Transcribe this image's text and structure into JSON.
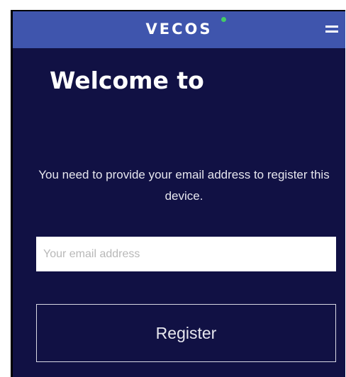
{
  "header": {
    "brand": "VECOS",
    "menu_icon": "hamburger-menu-icon",
    "status_dot_color": "#44cc66"
  },
  "main": {
    "title": "Welcome to",
    "instruction": "You need to provide your email address to register this device.",
    "email": {
      "value": "",
      "placeholder": "Your email address"
    },
    "register_label": "Register"
  },
  "colors": {
    "header_background": "#3f55ad",
    "screen_background": "#111144",
    "accent": "#44cc66"
  }
}
